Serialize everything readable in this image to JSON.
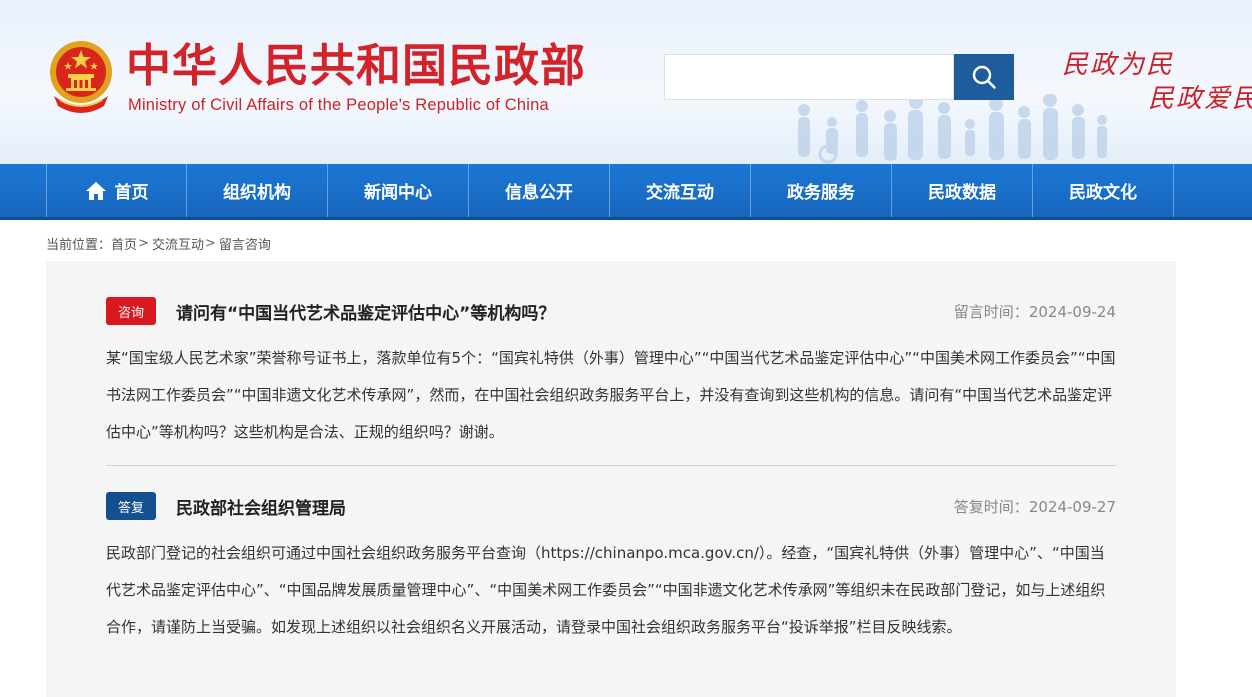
{
  "header": {
    "title_cn": "中华人民共和国民政部",
    "title_en": "Ministry of Civil Affairs of the People's Republic of China",
    "search_placeholder": "",
    "slogan_line1": "民政为民",
    "slogan_line2": "民政爱民"
  },
  "nav": {
    "items": [
      "首页",
      "组织机构",
      "新闻中心",
      "信息公开",
      "交流互动",
      "政务服务",
      "民政数据",
      "民政文化"
    ]
  },
  "breadcrumb": {
    "prefix": "当前位置：",
    "items": [
      "首页",
      "交流互动",
      "留言咨询"
    ],
    "separator": ">"
  },
  "question": {
    "badge": "咨询",
    "title": "请问有“中国当代艺术品鉴定评估中心”等机构吗？",
    "time_label": "留言时间：",
    "time_value": "2024-09-24",
    "body": "某“国宝级人民艺术家”荣誉称号证书上，落款单位有5个：“国宾礼特供（外事）管理中心”“中国当代艺术品鉴定评估中心”“中国美术网工作委员会”“中国书法网工作委员会”“中国非遗文化艺术传承网”，然而，在中国社会组织政务服务平台上，并没有查询到这些机构的信息。请问有“中国当代艺术品鉴定评估中心”等机构吗？这些机构是合法、正规的组织吗？谢谢。"
  },
  "answer": {
    "badge": "答复",
    "title": "民政部社会组织管理局",
    "time_label": "答复时间：",
    "time_value": "2024-09-27",
    "body": "民政部门登记的社会组织可通过中国社会组织政务服务平台查询（https://chinanpo.mca.gov.cn/）。经查，“国宾礼特供（外事）管理中心”、“中国当代艺术品鉴定评估中心”、“中国品牌发展质量管理中心”、“中国美术网工作委员会”“中国非遗文化艺术传承网”等组织未在民政部门登记，如与上述组织合作，请谨防上当受骗。如发现上述组织以社会组织名义开展活动，请登录中国社会组织政务服务平台“投诉举报”栏目反映线索。"
  },
  "colors": {
    "brand_red": "#d3232a",
    "nav_blue": "#1b77d3",
    "reply_blue": "#14508f",
    "ask_red": "#d7191f"
  },
  "icons": {
    "emblem": "national-emblem",
    "search": "search-icon",
    "home": "home-icon"
  }
}
